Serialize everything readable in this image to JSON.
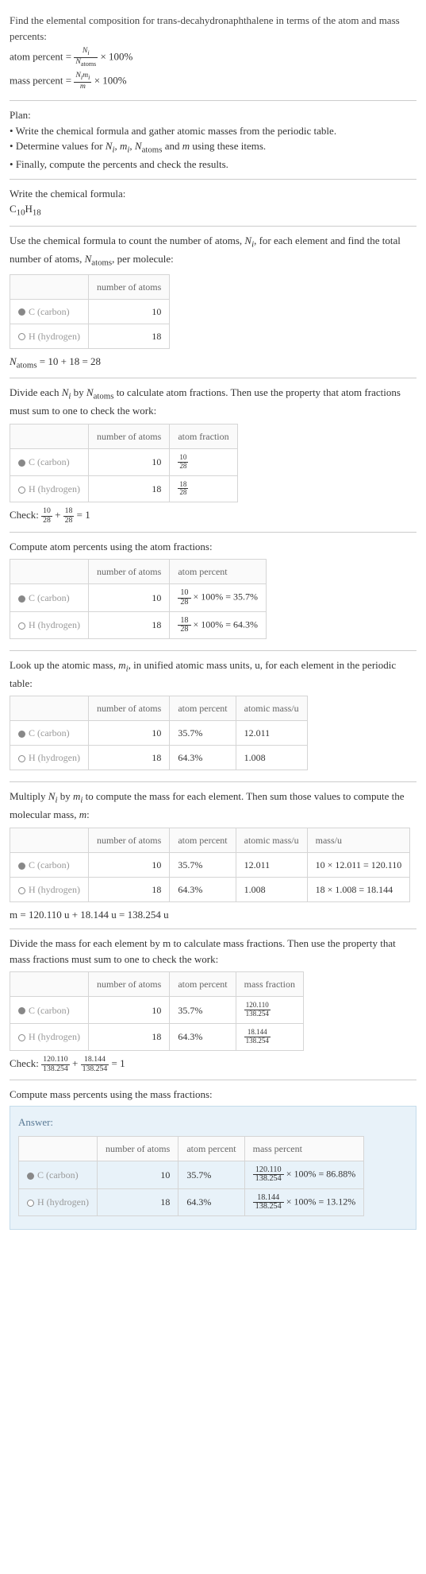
{
  "intro": {
    "title": "Find the elemental composition for trans-decahydronaphthalene in terms of the atom and mass percents:",
    "atom_percent_label": "atom percent = ",
    "atom_percent_rhs": " × 100%",
    "mass_percent_label": "mass percent = ",
    "mass_percent_rhs": " × 100%"
  },
  "plan": {
    "heading": "Plan:",
    "items": [
      "Write the chemical formula and gather atomic masses from the periodic table.",
      "Determine values for N_i, m_i, N_atoms and m using these items.",
      "Finally, compute the percents and check the results."
    ]
  },
  "chemformula": {
    "heading": "Write the chemical formula:",
    "base1": "C",
    "sub1": "10",
    "base2": "H",
    "sub2": "18"
  },
  "step_count": {
    "text1": "Use the chemical formula to count the number of atoms, ",
    "text2": ", for each element and find the total number of atoms, ",
    "text3": ", per molecule:",
    "col1": "number of atoms",
    "c_label": "C (carbon)",
    "h_label": "H (hydrogen)",
    "c_atoms": "10",
    "h_atoms": "18",
    "natoms_eq": " = 10 + 18 = 28"
  },
  "step_atomfrac": {
    "text1": "Divide each ",
    "text2": " by ",
    "text3": " to calculate atom fractions. Then use the property that atom fractions must sum to one to check the work:",
    "col1": "number of atoms",
    "col2": "atom fraction",
    "c_atoms": "10",
    "h_atoms": "18",
    "c_frac_num": "10",
    "c_frac_den": "28",
    "h_frac_num": "18",
    "h_frac_den": "28",
    "check_label": "Check: ",
    "check_eq": " = 1"
  },
  "step_atompercent": {
    "heading": "Compute atom percents using the atom fractions:",
    "col1": "number of atoms",
    "col2": "atom percent",
    "c_atoms": "10",
    "h_atoms": "18",
    "c_pct": " × 100% = 35.7%",
    "h_pct": " × 100% = 64.3%"
  },
  "step_mass": {
    "text1": "Look up the atomic mass, ",
    "text2": ", in unified atomic mass units, u, for each element in the periodic table:",
    "col1": "number of atoms",
    "col2": "atom percent",
    "col3": "atomic mass/u",
    "c_atoms": "10",
    "h_atoms": "18",
    "c_pct": "35.7%",
    "h_pct": "64.3%",
    "c_mass": "12.011",
    "h_mass": "1.008"
  },
  "step_multiply": {
    "text1": "Multiply ",
    "text2": " by ",
    "text3": " to compute the mass for each element. Then sum those values to compute the molecular mass, ",
    "text4": ":",
    "col1": "number of atoms",
    "col2": "atom percent",
    "col3": "atomic mass/u",
    "col4": "mass/u",
    "c_atoms": "10",
    "h_atoms": "18",
    "c_pct": "35.7%",
    "h_pct": "64.3%",
    "c_mass": "12.011",
    "h_mass": "1.008",
    "c_calc": "10 × 12.011 = 120.110",
    "h_calc": "18 × 1.008 = 18.144",
    "m_eq": "m = 120.110 u + 18.144 u = 138.254 u"
  },
  "step_massfrac": {
    "text": "Divide the mass for each element by m to calculate mass fractions. Then use the property that mass fractions must sum to one to check the work:",
    "col1": "number of atoms",
    "col2": "atom percent",
    "col3": "mass fraction",
    "c_atoms": "10",
    "h_atoms": "18",
    "c_pct": "35.7%",
    "h_pct": "64.3%",
    "c_frac_num": "120.110",
    "c_frac_den": "138.254",
    "h_frac_num": "18.144",
    "h_frac_den": "138.254",
    "check_label": "Check: ",
    "check_eq": " = 1"
  },
  "step_final": {
    "heading": "Compute mass percents using the mass fractions:",
    "answer_label": "Answer:",
    "col1": "number of atoms",
    "col2": "atom percent",
    "col3": "mass percent",
    "c_atoms": "10",
    "h_atoms": "18",
    "c_pct": "35.7%",
    "h_pct": "64.3%",
    "c_frac_num": "120.110",
    "c_frac_den": "138.254",
    "c_result": " × 100% = 86.88%",
    "h_frac_num": "18.144",
    "h_frac_den": "138.254",
    "h_result": " × 100% = 13.12%"
  },
  "chart_data": {
    "type": "table",
    "tables": [
      {
        "title": "number of atoms",
        "rows": [
          {
            "element": "C (carbon)",
            "atoms": 10
          },
          {
            "element": "H (hydrogen)",
            "atoms": 18
          }
        ],
        "N_atoms": 28
      },
      {
        "title": "atom fractions",
        "rows": [
          {
            "element": "C (carbon)",
            "atoms": 10,
            "fraction": "10/28"
          },
          {
            "element": "H (hydrogen)",
            "atoms": 18,
            "fraction": "18/28"
          }
        ],
        "check": "10/28 + 18/28 = 1"
      },
      {
        "title": "atom percents",
        "rows": [
          {
            "element": "C (carbon)",
            "atoms": 10,
            "atom_percent": "35.7%"
          },
          {
            "element": "H (hydrogen)",
            "atoms": 18,
            "atom_percent": "64.3%"
          }
        ]
      },
      {
        "title": "atomic mass",
        "rows": [
          {
            "element": "C (carbon)",
            "atoms": 10,
            "atom_percent": "35.7%",
            "atomic_mass_u": 12.011
          },
          {
            "element": "H (hydrogen)",
            "atoms": 18,
            "atom_percent": "64.3%",
            "atomic_mass_u": 1.008
          }
        ]
      },
      {
        "title": "mass",
        "rows": [
          {
            "element": "C (carbon)",
            "atoms": 10,
            "atom_percent": "35.7%",
            "atomic_mass_u": 12.011,
            "mass_u": 120.11
          },
          {
            "element": "H (hydrogen)",
            "atoms": 18,
            "atom_percent": "64.3%",
            "atomic_mass_u": 1.008,
            "mass_u": 18.144
          }
        ],
        "m_u": 138.254
      },
      {
        "title": "mass fractions",
        "rows": [
          {
            "element": "C (carbon)",
            "atoms": 10,
            "atom_percent": "35.7%",
            "mass_fraction": "120.110/138.254"
          },
          {
            "element": "H (hydrogen)",
            "atoms": 18,
            "atom_percent": "64.3%",
            "mass_fraction": "18.144/138.254"
          }
        ],
        "check": "120.110/138.254 + 18.144/138.254 = 1"
      },
      {
        "title": "mass percents (answer)",
        "rows": [
          {
            "element": "C (carbon)",
            "atoms": 10,
            "atom_percent": "35.7%",
            "mass_percent": "86.88%"
          },
          {
            "element": "H (hydrogen)",
            "atoms": 18,
            "atom_percent": "64.3%",
            "mass_percent": "13.12%"
          }
        ]
      }
    ]
  }
}
